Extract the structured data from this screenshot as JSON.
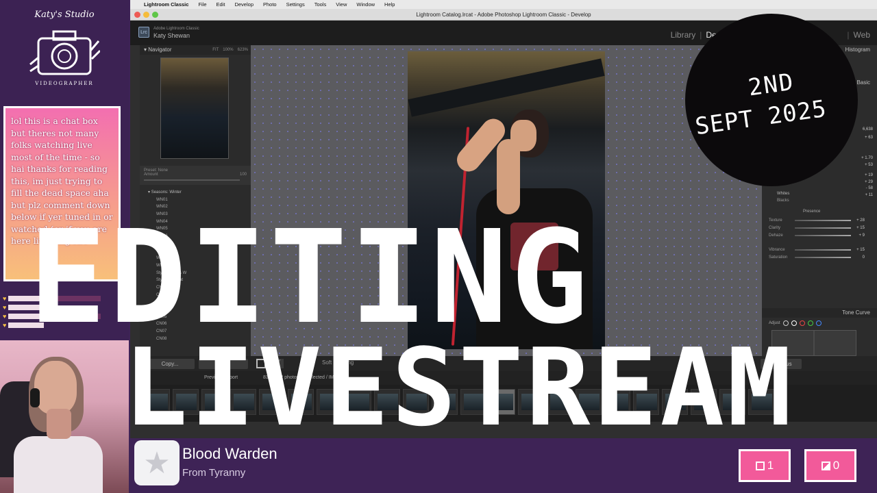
{
  "logo": {
    "title": "Katy's Studio",
    "subtitle": "VIDEOGRAPHER"
  },
  "chatbox": {
    "text": "lol this is a chat box but theres not many folks watching live most of the time - so hai thanks for reading this, im just trying to fill the dead space aha but plz comment down below if yer tuned in or watched (or if you are here live omg HA"
  },
  "mini_chat": {
    "names": [
      "",
      "",
      "",
      ""
    ]
  },
  "mac_menu": {
    "apple": "",
    "app_name": "Lightroom Classic",
    "items": [
      "File",
      "Edit",
      "Develop",
      "Photo",
      "Settings",
      "Tools",
      "View",
      "Window",
      "Help"
    ]
  },
  "window_title": "Lightroom Catalog.lrcat - Adobe Photoshop Lightroom Classic - Develop",
  "lr": {
    "logo": "Lrc",
    "identity_top": "Adobe Lightroom Classic",
    "identity_name": "Katy Shewan",
    "modules": [
      "Library",
      "Develop",
      "Web"
    ],
    "left_panel": {
      "navigator_label": "Navigator",
      "zoom_options": [
        "FIT",
        "100%",
        "623%"
      ],
      "preset_amount_label": "Preset: None",
      "preset_amount_value": "Amount",
      "preset_amount_right": "100",
      "preset_group": "Seasons: Winter",
      "presets": [
        "WN01",
        "WN02",
        "WN03",
        "WN04",
        "WN05",
        "WN06",
        "WN07",
        "WN08",
        "WN09",
        "WN10",
        "Style: Black & W",
        "Style: Cinemat",
        "CN01",
        "CN02",
        "CN03",
        "CN04",
        "CN05",
        "CN06",
        "CN07",
        "CN08"
      ]
    },
    "right_panel": {
      "histogram_label": "Histogram",
      "basic_label": "Basic",
      "temp_value": "6,638",
      "tint_value": "+ 63",
      "values": [
        "+ 1.70",
        "+ 53",
        "+ 19",
        "+ 29",
        "- 58",
        "+ 11"
      ],
      "whites_label": "Whites",
      "blacks_label": "Blacks",
      "presence_label": "Presence",
      "presence_rows": [
        {
          "label": "Texture",
          "value": "+ 28"
        },
        {
          "label": "Clarity",
          "value": "+ 15"
        },
        {
          "label": "Dehaze",
          "value": "+ 9"
        },
        {
          "label": "Vibrance",
          "value": "+ 15"
        },
        {
          "label": "Saturation",
          "value": "0"
        }
      ],
      "tone_curve_label": "Tone Curve",
      "adjust_label": "Adjust"
    },
    "toolbar": {
      "copy_label": "Copy...",
      "paste_label": "Paste",
      "proofing_label": "Soft Proofing",
      "previous_label": "Previous"
    },
    "filmstrip": {
      "previous_import_label": "Previous Import",
      "count_label": "83 of 352 photos / 1 selected / IMG_",
      "thumb_count": 22,
      "selected_index": 12
    }
  },
  "overlay": {
    "line1": "EDITING",
    "line2": "LIVESTREAM",
    "date_line1": "2ND",
    "date_line2": "SEPT 2025"
  },
  "now_playing": {
    "song": "Blood Warden",
    "artist": "From Tyranny",
    "btn1_count": "1",
    "btn2_count": "0"
  }
}
